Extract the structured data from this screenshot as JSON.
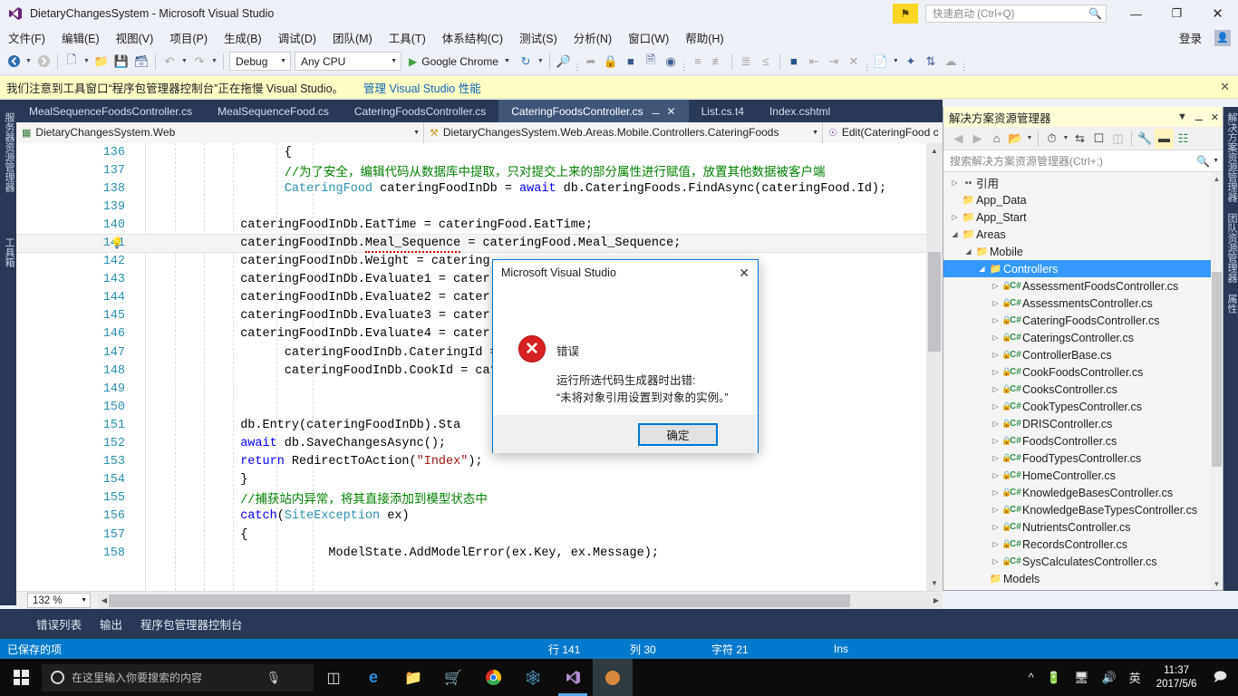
{
  "window": {
    "title": "DietaryChangesSystem - Microsoft Visual Studio",
    "logo_icon": "visual-studio-logo",
    "minimize": "—",
    "restore": "❐",
    "close": "✕",
    "signin_label": "登录",
    "quick_launch_placeholder": "快速启动 (Ctrl+Q)",
    "quick_launch_icon": "search-icon",
    "feedback_icon": "feedback-flag-icon"
  },
  "menubar": {
    "items": [
      "文件(F)",
      "编辑(E)",
      "视图(V)",
      "项目(P)",
      "生成(B)",
      "调试(D)",
      "团队(M)",
      "工具(T)",
      "体系结构(C)",
      "测试(S)",
      "分析(N)",
      "窗口(W)",
      "帮助(H)"
    ]
  },
  "toolbar": {
    "config": "Debug",
    "platform": "Any CPU",
    "run_target": "Google Chrome",
    "icons": [
      "navigate-back-icon",
      "navigate-forward-icon",
      "new-project-icon",
      "open-file-icon",
      "save-icon",
      "save-all-icon",
      "undo-icon",
      "redo-icon",
      "restart-icon",
      "find-icon",
      "step-icon",
      "breakpoint-icon",
      "attach-icon",
      "solution-icon",
      "comment-icon",
      "uncomment-icon",
      "indent-icon",
      "outdent-icon",
      "bookmark-icon",
      "prev-bookmark-icon",
      "next-bookmark-icon",
      "clear-bookmark-icon",
      "error-list-icon",
      "new-item-icon",
      "refresh-icon",
      "sync-icon"
    ]
  },
  "notification": {
    "text": "我们注意到工具窗口“程序包管理器控制台”正在拖慢 Visual Studio。",
    "link": "管理 Visual Studio 性能",
    "close_icon": "close-icon"
  },
  "left_vertical_tabs": [
    "服务器资源管理器",
    "工具箱"
  ],
  "right_vertical_tabs": [
    "解决方案资源管理器",
    "团队资源管理器",
    "属性"
  ],
  "editor_tabs": [
    {
      "label": "MealSequenceFoodsController.cs",
      "active": false
    },
    {
      "label": "MealSequenceFood.cs",
      "active": false
    },
    {
      "label": "CateringFoodsController.cs",
      "active": false
    },
    {
      "label": "CateringFoodsController.cs",
      "active": true,
      "pin_icon": "pin-icon",
      "close_icon": "close-icon"
    },
    {
      "label": "List.cs.t4",
      "active": false
    },
    {
      "label": "Index.cshtml",
      "active": false
    }
  ],
  "navbar": {
    "project": "DietaryChangesSystem.Web",
    "project_icon": "web-project-icon",
    "namespace": "DietaryChangesSystem.Web.Areas.Mobile.Controllers.CateringFoods",
    "namespace_icon": "class-icon",
    "member": "Edit(CateringFood c",
    "member_icon": "method-icon"
  },
  "code": {
    "lines": [
      {
        "n": "136",
        "indent": 18,
        "bulb": false,
        "current": false,
        "parts": [
          {
            "t": "{",
            "c": "plain"
          }
        ]
      },
      {
        "n": "137",
        "indent": 18,
        "bulb": false,
        "current": false,
        "parts": [
          {
            "t": "//为了安全，编辑代码从数据库中提取，只对提交上来的部分属性进行赋值，放置其他数据被客户端",
            "c": "comment"
          }
        ]
      },
      {
        "n": "138",
        "indent": 18,
        "bulb": false,
        "current": false,
        "parts": [
          {
            "t": "CateringFood",
            "c": "type"
          },
          {
            "t": " cateringFoodInDb = ",
            "c": "plain"
          },
          {
            "t": "await",
            "c": "keyword"
          },
          {
            "t": " db.CateringFoods.FindAsync(cateringFood.Id);",
            "c": "plain"
          }
        ]
      },
      {
        "n": "139",
        "indent": 0,
        "bulb": false,
        "current": false,
        "parts": []
      },
      {
        "n": "140",
        "indent": 12,
        "bulb": false,
        "current": false,
        "parts": [
          {
            "t": "cateringFoodInDb.EatTime = cateringFood.EatTime;",
            "c": "plain"
          }
        ]
      },
      {
        "n": "141",
        "indent": 12,
        "bulb": true,
        "current": true,
        "parts": [
          {
            "t": "cateringFoodInDb.",
            "c": "plain"
          },
          {
            "t": "Meal_Sequence",
            "c": "squiggle"
          },
          {
            "t": " = cateringFood.Meal_Sequence;",
            "c": "plain"
          }
        ]
      },
      {
        "n": "142",
        "indent": 12,
        "bulb": false,
        "current": false,
        "parts": [
          {
            "t": "cateringFoodInDb.Weight = catering",
            "c": "plain"
          }
        ]
      },
      {
        "n": "143",
        "indent": 12,
        "bulb": false,
        "current": false,
        "parts": [
          {
            "t": "cateringFoodInDb.Evaluate1 = cater",
            "c": "plain"
          }
        ]
      },
      {
        "n": "144",
        "indent": 12,
        "bulb": false,
        "current": false,
        "parts": [
          {
            "t": "cateringFoodInDb.Evaluate2 = cater",
            "c": "plain"
          }
        ]
      },
      {
        "n": "145",
        "indent": 12,
        "bulb": false,
        "current": false,
        "parts": [
          {
            "t": "cateringFoodInDb.Evaluate3 = cater",
            "c": "plain"
          }
        ]
      },
      {
        "n": "146",
        "indent": 12,
        "bulb": false,
        "current": false,
        "parts": [
          {
            "t": "cateringFoodInDb.Evaluate4 = cater",
            "c": "plain"
          }
        ]
      },
      {
        "n": "147",
        "indent": 18,
        "bulb": false,
        "current": false,
        "parts": [
          {
            "t": "cateringFoodInDb.CateringId = ",
            "c": "plain"
          }
        ]
      },
      {
        "n": "148",
        "indent": 18,
        "bulb": false,
        "current": false,
        "parts": [
          {
            "t": "cateringFoodInDb.CookId = cate",
            "c": "plain"
          }
        ]
      },
      {
        "n": "149",
        "indent": 0,
        "bulb": false,
        "current": false,
        "parts": []
      },
      {
        "n": "150",
        "indent": 0,
        "bulb": false,
        "current": false,
        "parts": []
      },
      {
        "n": "151",
        "indent": 12,
        "bulb": false,
        "current": false,
        "parts": [
          {
            "t": "db.Entry(cateringFoodInDb).Sta",
            "c": "plain"
          }
        ]
      },
      {
        "n": "152",
        "indent": 12,
        "bulb": false,
        "current": false,
        "parts": [
          {
            "t": "await",
            "c": "keyword"
          },
          {
            "t": " db.SaveChangesAsync();",
            "c": "plain"
          }
        ]
      },
      {
        "n": "153",
        "indent": 12,
        "bulb": false,
        "current": false,
        "parts": [
          {
            "t": "return",
            "c": "keyword"
          },
          {
            "t": " RedirectToAction(",
            "c": "plain"
          },
          {
            "t": "\"Index\"",
            "c": "string"
          },
          {
            "t": ");",
            "c": "plain"
          }
        ]
      },
      {
        "n": "154",
        "indent": 12,
        "bulb": false,
        "current": false,
        "parts": [
          {
            "t": "}",
            "c": "plain"
          }
        ]
      },
      {
        "n": "155",
        "indent": 12,
        "bulb": false,
        "current": false,
        "parts": [
          {
            "t": "//捕获站内异常，将其直接添加到模型状态中",
            "c": "comment"
          }
        ]
      },
      {
        "n": "156",
        "indent": 12,
        "bulb": false,
        "current": false,
        "parts": [
          {
            "t": "catch",
            "c": "keyword"
          },
          {
            "t": "(",
            "c": "plain"
          },
          {
            "t": "SiteException",
            "c": "type"
          },
          {
            "t": " ex)",
            "c": "plain"
          }
        ]
      },
      {
        "n": "157",
        "indent": 12,
        "bulb": false,
        "current": false,
        "parts": [
          {
            "t": "{",
            "c": "plain"
          }
        ]
      },
      {
        "n": "158",
        "indent": 24,
        "bulb": false,
        "current": false,
        "parts": [
          {
            "t": "ModelState.AddModelError(ex.Key, ex.Message);",
            "c": "plain"
          }
        ]
      }
    ],
    "zoom_level": "132 %"
  },
  "dialog": {
    "title": "Microsoft Visual Studio",
    "close_icon": "close-icon",
    "severity_icon": "error-icon",
    "heading": "错误",
    "message_line1": "运行所选代码生成器时出错:",
    "message_line2": "“未将对象引用设置到对象的实例。”",
    "ok_label": "确定",
    "accent_color": "#0078d7",
    "error_color": "#d62121"
  },
  "solution_explorer": {
    "title": "解决方案资源管理器",
    "header_icons": [
      "chevron-down-icon",
      "pin-icon",
      "close-icon"
    ],
    "toolbar_icons": [
      "back-icon",
      "forward-icon",
      "home-icon",
      "scope-icon",
      "chevron-down-icon",
      "pending-changes-icon",
      "chevron-down-icon",
      "sync-with-editor-icon",
      "refresh-icon",
      "collapse-all-icon",
      "show-all-files-icon",
      "properties-icon",
      "preview-selected-icon",
      "class-view-icon"
    ],
    "search_placeholder": "搜索解决方案资源管理器(Ctrl+;)",
    "search_icon": "search-icon",
    "search_filter_icon": "chevron-down-icon",
    "tree": [
      {
        "label": "引用",
        "depth": 1,
        "arrow": "collapsed",
        "icon": "references-icon",
        "kind": "ref"
      },
      {
        "label": "App_Data",
        "depth": 1,
        "arrow": "none",
        "icon": "folder-icon",
        "kind": "folder"
      },
      {
        "label": "App_Start",
        "depth": 1,
        "arrow": "collapsed",
        "icon": "folder-icon",
        "kind": "folder"
      },
      {
        "label": "Areas",
        "depth": 1,
        "arrow": "expanded",
        "icon": "folder-open-icon",
        "kind": "folder"
      },
      {
        "label": "Mobile",
        "depth": 2,
        "arrow": "expanded",
        "icon": "folder-open-icon",
        "kind": "folder"
      },
      {
        "label": "Controllers",
        "depth": 3,
        "arrow": "expanded",
        "icon": "folder-open-icon",
        "kind": "folder",
        "selected": true
      },
      {
        "label": "AssessmentFoodsController.cs",
        "depth": 4,
        "arrow": "collapsed",
        "icon": "csharp-file-icon",
        "kind": "cs"
      },
      {
        "label": "AssessmentsController.cs",
        "depth": 4,
        "arrow": "collapsed",
        "icon": "csharp-file-icon",
        "kind": "cs"
      },
      {
        "label": "CateringFoodsController.cs",
        "depth": 4,
        "arrow": "collapsed",
        "icon": "csharp-file-icon",
        "kind": "cs"
      },
      {
        "label": "CateringsController.cs",
        "depth": 4,
        "arrow": "collapsed",
        "icon": "csharp-file-icon",
        "kind": "cs"
      },
      {
        "label": "ControllerBase.cs",
        "depth": 4,
        "arrow": "collapsed",
        "icon": "csharp-file-icon",
        "kind": "cs"
      },
      {
        "label": "CookFoodsController.cs",
        "depth": 4,
        "arrow": "collapsed",
        "icon": "csharp-file-icon",
        "kind": "cs"
      },
      {
        "label": "CooksController.cs",
        "depth": 4,
        "arrow": "collapsed",
        "icon": "csharp-file-icon",
        "kind": "cs"
      },
      {
        "label": "CookTypesController.cs",
        "depth": 4,
        "arrow": "collapsed",
        "icon": "csharp-file-icon",
        "kind": "cs"
      },
      {
        "label": "DRISController.cs",
        "depth": 4,
        "arrow": "collapsed",
        "icon": "csharp-file-icon",
        "kind": "cs"
      },
      {
        "label": "FoodsController.cs",
        "depth": 4,
        "arrow": "collapsed",
        "icon": "csharp-file-icon",
        "kind": "cs"
      },
      {
        "label": "FoodTypesController.cs",
        "depth": 4,
        "arrow": "collapsed",
        "icon": "csharp-file-icon",
        "kind": "cs"
      },
      {
        "label": "HomeController.cs",
        "depth": 4,
        "arrow": "collapsed",
        "icon": "csharp-file-icon",
        "kind": "cs"
      },
      {
        "label": "KnowledgeBasesController.cs",
        "depth": 4,
        "arrow": "collapsed",
        "icon": "csharp-file-icon",
        "kind": "cs"
      },
      {
        "label": "KnowledgeBaseTypesController.cs",
        "depth": 4,
        "arrow": "collapsed",
        "icon": "csharp-file-icon",
        "kind": "cs"
      },
      {
        "label": "NutrientsController.cs",
        "depth": 4,
        "arrow": "collapsed",
        "icon": "csharp-file-icon",
        "kind": "cs"
      },
      {
        "label": "RecordsController.cs",
        "depth": 4,
        "arrow": "collapsed",
        "icon": "csharp-file-icon",
        "kind": "cs"
      },
      {
        "label": "SysCalculatesController.cs",
        "depth": 4,
        "arrow": "collapsed",
        "icon": "csharp-file-icon",
        "kind": "cs"
      },
      {
        "label": "Models",
        "depth": 3,
        "arrow": "none",
        "icon": "folder-icon",
        "kind": "folder"
      }
    ]
  },
  "dock_tabs": [
    "错误列表",
    "输出",
    "程序包管理器控制台"
  ],
  "statusbar": {
    "message": "已保存的项",
    "row": "行 141",
    "col": "列 30",
    "char": "字符 21",
    "insert_mode": "Ins",
    "accent_color": "#007acc"
  },
  "taskbar": {
    "start_icon": "windows-start-icon",
    "search_placeholder": "在这里输入你要搜索的内容",
    "search_circle_icon": "cortana-icon",
    "mic_icon": "microphone-icon",
    "taskview_icon": "task-view-icon",
    "apps": [
      "edge-icon",
      "file-explorer-icon",
      "store-icon",
      "chrome-icon",
      "xmind-icon",
      "visual-studio-icon",
      "running-app-icon"
    ],
    "tray_icons": [
      "show-hidden-icons-icon",
      "battery-icon",
      "network-icon",
      "volume-icon"
    ],
    "ime_label": "英",
    "clock_time": "11:37",
    "clock_date": "2017/5/6",
    "notification_icon": "action-center-icon"
  }
}
